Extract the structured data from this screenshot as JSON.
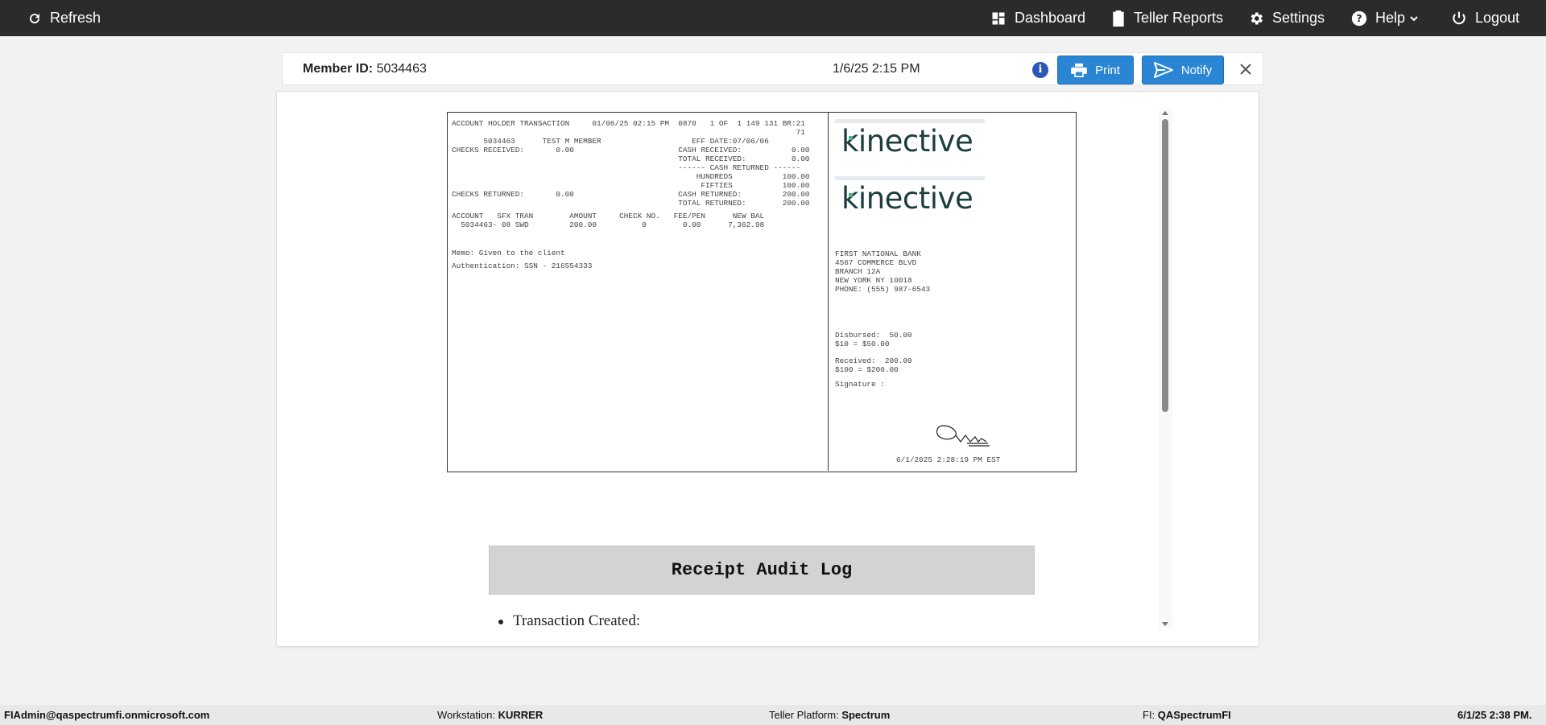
{
  "nav": {
    "refresh": "Refresh",
    "dashboard": "Dashboard",
    "teller_reports": "Teller Reports",
    "settings": "Settings",
    "help": "Help",
    "logout": "Logout"
  },
  "member_bar": {
    "label": "Member ID:",
    "member_id": "5034463",
    "datetime": "1/6/25 2:15 PM",
    "print_label": "Print",
    "notify_label": "Notify",
    "info_glyph": "i"
  },
  "receipt": {
    "left_lines": [
      "ACCOUNT HOLDER TRANSACTION     01/06/25 02:15 PM  0870   1 OF  1 149 131 BR:21",
      "                                                                            71",
      "       5034463      TEST M MEMBER                    EFF DATE:07/06/06",
      "CHECKS RECEIVED:       0.00                       CASH RECEIVED:           0.00",
      "                                                  TOTAL RECEIVED:          0.00",
      "                                                  ------ CASH RETURNED ------",
      "                                                      HUNDREDS           100.00",
      "                                                       FIFTIES           100.00",
      "CHECKS RETURNED:       0.00                       CASH RETURNED:         200.00",
      "                                                  TOTAL RETURNED:        200.00",
      "ACCOUNT   SFX TRAN        AMOUNT     CHECK NO.   FEE/PEN      NEW BAL",
      "  5034463- 08 SWD         200.00          0        0.00      7,362.98"
    ],
    "memo": "Memo: Given to the client",
    "authentication": "Authentication: SSN - 216554333",
    "logo_text": "kinective",
    "bank_lines": [
      "FIRST NATIONAL BANK",
      "4567 COMMERCE BLVD",
      "BRANCH 12A",
      "NEW YORK NY 10018",
      "PHONE: (555) 987-6543"
    ],
    "disbursed": "Disbursed:  50.00",
    "disbursed_detail": "$10 = $50.00",
    "received": "Received:  200.00",
    "received_detail": "$100 = $200.00",
    "signature_label": "Signature :",
    "signature_timestamp": "6/1/2025 2:28:19 PM EST"
  },
  "audit": {
    "title": "Receipt Audit Log",
    "items": [
      "Transaction Created:"
    ]
  },
  "footer": {
    "user": "FIAdmin@qaspectrumfi.onmicrosoft.com",
    "workstation_label": "Workstation: ",
    "workstation": "KURRER",
    "platform_label": "Teller Platform: ",
    "platform": "Spectrum",
    "fi_label": "FI: ",
    "fi": "QASpectrumFI",
    "datetime": "6/1/25 2:38 PM."
  },
  "colors": {
    "topbar": "#2b2b2b",
    "primary_button": "#2a86d4",
    "info_icon": "#2a57b8",
    "audit_header": "#d3d3d3",
    "logo_text": "#1d3d3f",
    "logo_accent": "#4db380"
  }
}
